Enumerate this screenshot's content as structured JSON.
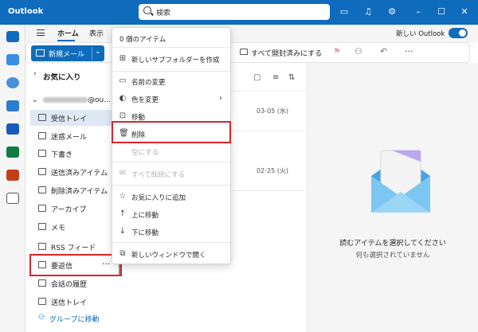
{
  "app": {
    "name": "Outlook"
  },
  "search": {
    "placeholder": "検索"
  },
  "ribbon": {
    "tabs": [
      {
        "label": "ホーム",
        "active": true
      },
      {
        "label": "表示",
        "active": false
      }
    ],
    "new_outlook_label": "新しい Outlook",
    "new_outlook_enabled": true
  },
  "toolbar": {
    "new_mail_label": "新規メール",
    "mark_all_read_label": "すべて開封済みにする"
  },
  "folders": {
    "favorites_label": "お気に入り",
    "account_suffix": "@ou...",
    "items": [
      {
        "label": "受信トレイ",
        "icon": "inbox-icon",
        "selected": true
      },
      {
        "label": "迷惑メール",
        "icon": "junk-icon",
        "selected": false
      },
      {
        "label": "下書き",
        "icon": "pencil-icon",
        "selected": false
      },
      {
        "label": "送信済みアイテム",
        "icon": "send-icon",
        "selected": false
      },
      {
        "label": "削除済みアイテム",
        "icon": "trash-icon",
        "selected": false
      },
      {
        "label": "アーカイブ",
        "icon": "archive-icon",
        "selected": false
      },
      {
        "label": "メモ",
        "icon": "note-icon",
        "selected": false
      },
      {
        "label": "RSS フィード",
        "icon": "folder-icon",
        "selected": false
      },
      {
        "label": "要返信",
        "icon": "folder-icon",
        "selected": false
      },
      {
        "label": "会話の履歴",
        "icon": "folder-icon",
        "selected": false
      },
      {
        "label": "送信トレイ",
        "icon": "outbox-icon",
        "selected": false
      }
    ],
    "group_link_label": "グループに移動"
  },
  "message_list": {
    "dates": [
      "03-05 (水)",
      "02-25 (火)"
    ]
  },
  "reading_pane": {
    "title": "読むアイテムを選択してください",
    "subtitle": "何も選択されていません"
  },
  "context_menu": {
    "header": "0 個のアイテム",
    "items": [
      {
        "label": "新しいサブフォルダーを作成",
        "icon": "new-folder-icon",
        "disabled": false
      },
      {
        "label": "名前の変更",
        "icon": "rename-icon",
        "disabled": false
      },
      {
        "label": "色を変更",
        "icon": "palette-icon",
        "disabled": false,
        "submenu": true
      },
      {
        "label": "移動",
        "icon": "move-folder-icon",
        "disabled": false
      },
      {
        "label": "削除",
        "icon": "trash-icon",
        "disabled": false
      },
      {
        "label": "空にする",
        "icon": "",
        "disabled": true
      },
      {
        "label": "すべて既読にする",
        "icon": "mail-read-icon",
        "disabled": true
      },
      {
        "label": "お気に入りに追加",
        "icon": "star-icon",
        "disabled": false
      },
      {
        "label": "上に移動",
        "icon": "arrow-up-icon",
        "disabled": false
      },
      {
        "label": "下に移動",
        "icon": "arrow-down-icon",
        "disabled": false
      },
      {
        "label": "新しいウィンドウで開く",
        "icon": "open-window-icon",
        "disabled": false
      }
    ]
  },
  "colors": {
    "accent": "#0f6cbd",
    "highlight": "#d9252b",
    "selected_bg": "#dfe8f5"
  }
}
